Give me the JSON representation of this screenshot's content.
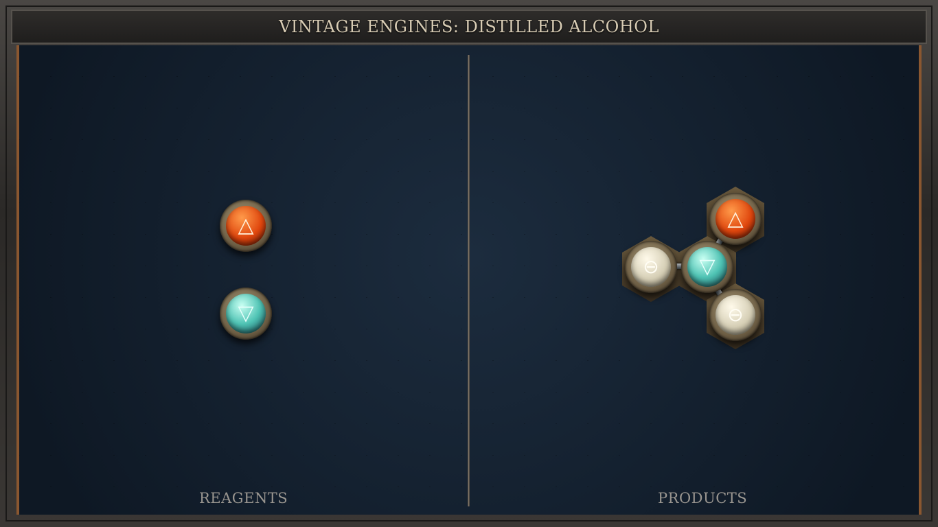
{
  "title": "VINTAGE ENGINES: DISTILLED ALCOHOL",
  "panels": {
    "reagents_label": "REAGENTS",
    "products_label": "PRODUCTS"
  },
  "reagents": [
    {
      "element": "fire",
      "icon": "fire-triangle-icon",
      "glyph": "△"
    },
    {
      "element": "water",
      "icon": "water-triangle-icon",
      "glyph": "▽"
    }
  ],
  "product": {
    "atoms": [
      {
        "element": "fire",
        "icon": "fire-triangle-icon",
        "glyph": "△"
      },
      {
        "element": "water",
        "icon": "water-triangle-icon",
        "glyph": "▽"
      },
      {
        "element": "salt",
        "icon": "salt-circle-icon",
        "glyph": "⊖"
      },
      {
        "element": "salt",
        "icon": "salt-circle-icon",
        "glyph": "⊖"
      }
    ],
    "bonds": [
      [
        "water",
        "fire"
      ],
      [
        "water",
        "salt"
      ],
      [
        "water",
        "salt"
      ]
    ]
  },
  "colors": {
    "fire": "#e0470e",
    "water": "#4fc3b4",
    "salt": "#d6cfb6",
    "frame": "#8a5730"
  }
}
